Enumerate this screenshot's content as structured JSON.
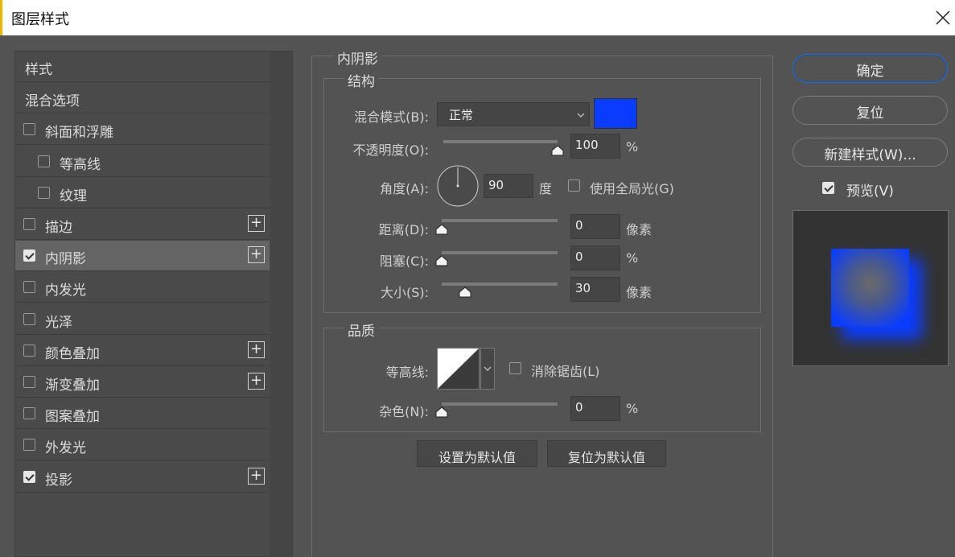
{
  "window": {
    "title": "图层样式"
  },
  "left_panel": {
    "items": [
      {
        "label": "样式",
        "checkbox": null,
        "indent": 0,
        "plus": false,
        "selected": false
      },
      {
        "label": "混合选项",
        "checkbox": null,
        "indent": 0,
        "plus": false,
        "selected": false
      },
      {
        "label": "斜面和浮雕",
        "checkbox": false,
        "indent": 0,
        "plus": false,
        "selected": false
      },
      {
        "label": "等高线",
        "checkbox": false,
        "indent": 1,
        "plus": false,
        "selected": false
      },
      {
        "label": "纹理",
        "checkbox": false,
        "indent": 1,
        "plus": false,
        "selected": false
      },
      {
        "label": "描边",
        "checkbox": false,
        "indent": 0,
        "plus": true,
        "selected": false
      },
      {
        "label": "内阴影",
        "checkbox": true,
        "indent": 0,
        "plus": true,
        "selected": true
      },
      {
        "label": "内发光",
        "checkbox": false,
        "indent": 0,
        "plus": false,
        "selected": false
      },
      {
        "label": "光泽",
        "checkbox": false,
        "indent": 0,
        "plus": false,
        "selected": false
      },
      {
        "label": "颜色叠加",
        "checkbox": false,
        "indent": 0,
        "plus": true,
        "selected": false
      },
      {
        "label": "渐变叠加",
        "checkbox": false,
        "indent": 0,
        "plus": true,
        "selected": false
      },
      {
        "label": "图案叠加",
        "checkbox": false,
        "indent": 0,
        "plus": false,
        "selected": false
      },
      {
        "label": "外发光",
        "checkbox": false,
        "indent": 0,
        "plus": false,
        "selected": false
      },
      {
        "label": "投影",
        "checkbox": true,
        "indent": 0,
        "plus": true,
        "selected": false
      }
    ],
    "plus_glyph": "+"
  },
  "main": {
    "section_title": "内阴影",
    "structure": {
      "title": "结构",
      "blend_mode": {
        "label": "混合模式(B):",
        "value": "正常",
        "color": "#0a3cff"
      },
      "opacity": {
        "label": "不透明度(O):",
        "value": "100",
        "unit": "%",
        "fraction": 1.0
      },
      "angle": {
        "label": "角度(A):",
        "value": "90",
        "unit": "度",
        "degrees": 90
      },
      "global_light": {
        "label": "使用全局光(G)",
        "checked": false
      },
      "distance": {
        "label": "距离(D):",
        "value": "0",
        "unit": "像素",
        "fraction": 0.0
      },
      "choke": {
        "label": "阻塞(C):",
        "value": "0",
        "unit": "%",
        "fraction": 0.0
      },
      "size": {
        "label": "大小(S):",
        "value": "30",
        "unit": "像素",
        "fraction": 0.2
      }
    },
    "quality": {
      "title": "品质",
      "contour": {
        "label": "等高线:"
      },
      "anti_alias": {
        "label": "消除锯齿(L)",
        "checked": false
      },
      "noise": {
        "label": "杂色(N):",
        "value": "0",
        "unit": "%",
        "fraction": 0.0
      }
    },
    "buttons": {
      "make_default": "设置为默认值",
      "reset_default": "复位为默认值"
    }
  },
  "right": {
    "ok": "确定",
    "reset": "复位",
    "new_style": "新建样式(W)...",
    "preview": {
      "label": "预览(V)",
      "checked": true
    }
  },
  "colors": {
    "accent": "#0a3cff",
    "selection": "#646464",
    "panel": "#535353"
  }
}
